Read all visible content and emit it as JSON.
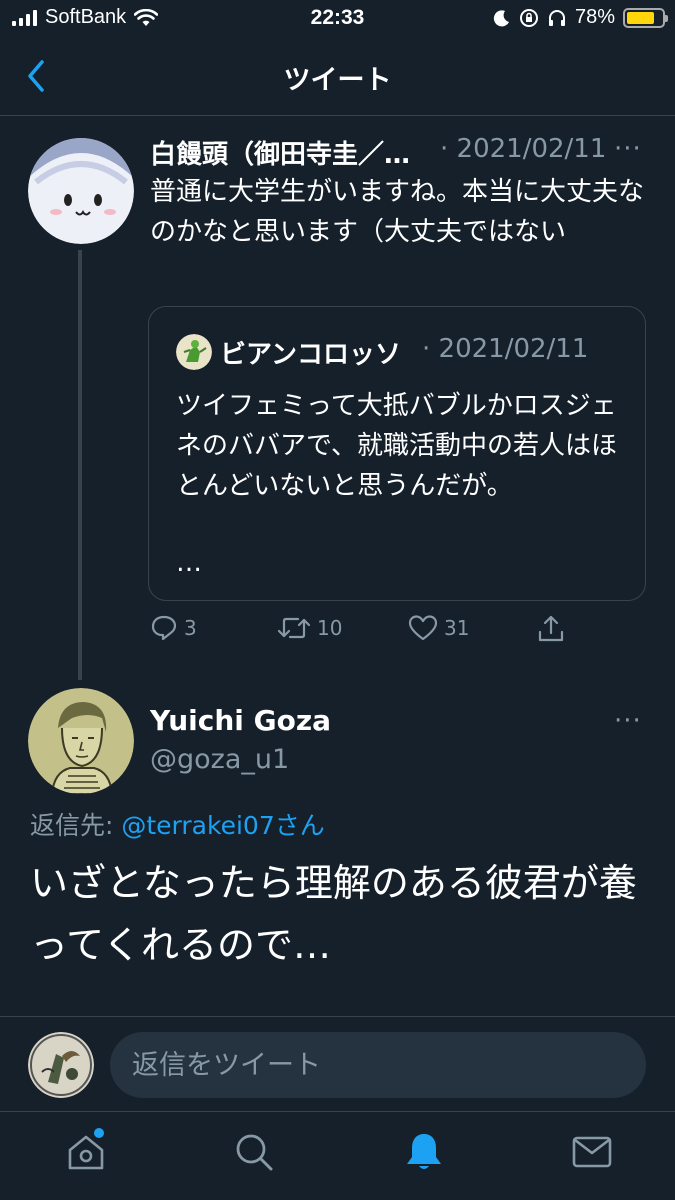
{
  "status_bar": {
    "carrier": "SoftBank",
    "time": "22:33",
    "battery": "78%",
    "battery_level": 0.78
  },
  "header": {
    "title": "ツイート"
  },
  "tweet1": {
    "name": "白饅頭（御田寺圭／…",
    "date": "· 2021/02/11",
    "more": "···",
    "text": "普通に大学生がいますね。本当に大丈夫なのかなと思います（大丈夫ではない",
    "quote": {
      "name": "ビアンコロッソ",
      "date": "· 2021/02/11",
      "text": "ツイフェミって大抵バブルかロスジェネのババアで、就職活動中の若人はほとんどいないと思うんだが。",
      "ellipsis": "…"
    },
    "actions": {
      "replies": "3",
      "retweets": "10",
      "likes": "31"
    }
  },
  "tweet2": {
    "name": "Yuichi Goza",
    "handle": "@goza_u1",
    "more": "···",
    "reply_prefix": "返信先: ",
    "reply_mention": "@terrakei07さん",
    "text": "いざとなったら理解のある彼君が養ってくれるので…"
  },
  "reply_box": {
    "placeholder": "返信をツイート"
  },
  "colors": {
    "background": "#15202b",
    "accent": "#1da1f2",
    "secondary_text": "#8899a6",
    "divider": "#38444d"
  }
}
